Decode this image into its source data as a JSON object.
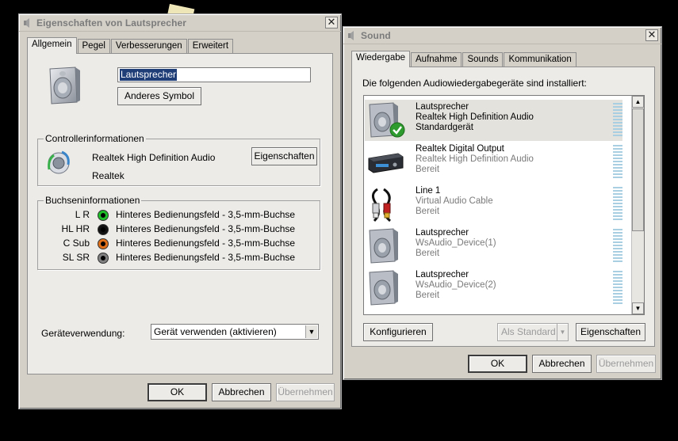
{
  "left_window": {
    "title": "Eigenschaften von Lautsprecher",
    "close_glyph": "✕",
    "tabs": [
      {
        "label": "Allgemein",
        "active": true
      },
      {
        "label": "Pegel",
        "active": false
      },
      {
        "label": "Verbesserungen",
        "active": false
      },
      {
        "label": "Erweitert",
        "active": false
      }
    ],
    "device_name": "Lautsprecher",
    "change_icon_button": "Anderes Symbol",
    "controller_group": {
      "title": "Controllerinformationen",
      "name": "Realtek High Definition Audio",
      "vendor": "Realtek",
      "properties_button": "Eigenschaften"
    },
    "jack_group": {
      "title": "Buchseninformationen",
      "jacks": [
        {
          "channel": "L R",
          "color": "#1fbf2a",
          "description": "Hinteres Bedienungsfeld - 3,5-mm-Buchse"
        },
        {
          "channel": "HL HR",
          "color": "#000000",
          "description": "Hinteres Bedienungsfeld - 3,5-mm-Buchse"
        },
        {
          "channel": "C Sub",
          "color": "#e0701a",
          "description": "Hinteres Bedienungsfeld - 3,5-mm-Buchse"
        },
        {
          "channel": "SL SR",
          "color": "#808080",
          "description": "Hinteres Bedienungsfeld - 3,5-mm-Buchse"
        }
      ]
    },
    "device_usage": {
      "label": "Geräteverwendung:",
      "value": "Gerät verwenden (aktivieren)"
    },
    "buttons": {
      "ok": "OK",
      "cancel": "Abbrechen",
      "apply": "Übernehmen"
    }
  },
  "right_window": {
    "title": "Sound",
    "close_glyph": "✕",
    "tabs": [
      {
        "label": "Wiedergabe",
        "active": true
      },
      {
        "label": "Aufnahme",
        "active": false
      },
      {
        "label": "Sounds",
        "active": false
      },
      {
        "label": "Kommunikation",
        "active": false
      }
    ],
    "instruction": "Die folgenden Audiowiedergabegeräte sind installiert:",
    "devices": [
      {
        "name": "Lautsprecher",
        "driver": "Realtek High Definition Audio",
        "status": "Standardgerät",
        "icon": "speaker-icon",
        "selected": true,
        "default": true
      },
      {
        "name": "Realtek Digital Output",
        "driver": "Realtek High Definition Audio",
        "status": "Bereit",
        "icon": "digital-output-icon",
        "selected": false,
        "default": false
      },
      {
        "name": "Line 1",
        "driver": "Virtual Audio Cable",
        "status": "Bereit",
        "icon": "rca-cable-icon",
        "selected": false,
        "default": false
      },
      {
        "name": "Lautsprecher",
        "driver": "WsAudio_Device(1)",
        "status": "Bereit",
        "icon": "speaker-icon",
        "selected": false,
        "default": false
      },
      {
        "name": "Lautsprecher",
        "driver": "WsAudio_Device(2)",
        "status": "Bereit",
        "icon": "speaker-icon",
        "selected": false,
        "default": false
      }
    ],
    "buttons": {
      "configure": "Konfigurieren",
      "set_default": "Als Standard",
      "properties": "Eigenschaften",
      "ok": "OK",
      "cancel": "Abbrechen",
      "apply": "Übernehmen"
    },
    "scroll_up_glyph": "▲",
    "scroll_down_glyph": "▼",
    "dropdown_glyph": "▼"
  },
  "colors": {
    "desktop": "#000000",
    "window_face": "#d4d0c8",
    "tab_panel": "#ecebe8",
    "title_text": "#7b7b7b",
    "jack_green": "#1fbf2a",
    "jack_orange": "#e0701a",
    "check_green": "#2e9b2e"
  }
}
